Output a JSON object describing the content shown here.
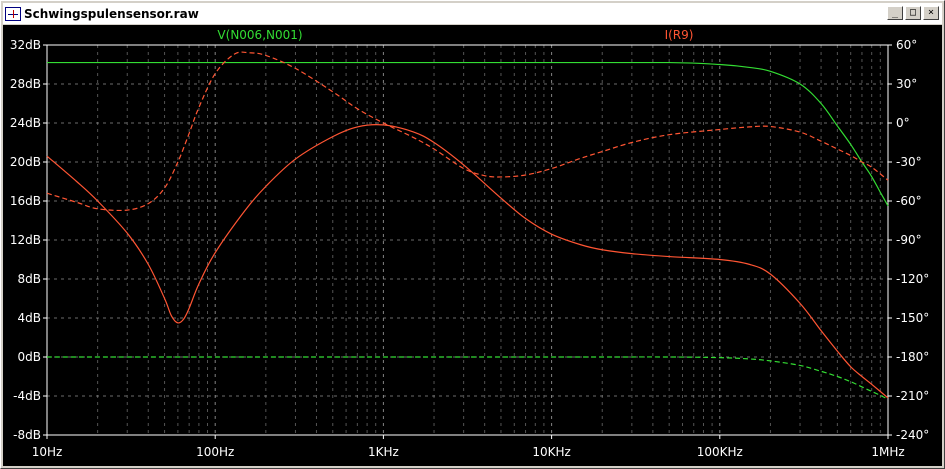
{
  "window": {
    "title": "Schwingspulensensor.raw",
    "min_label": "_",
    "max_label": "□",
    "close_label": "×"
  },
  "colors": {
    "background": "#000000",
    "grid": "#9a9a9a",
    "tick_text": "#ffffff",
    "series_green": "#33dd33",
    "series_red": "#ff5533"
  },
  "chart_data": {
    "type": "line",
    "x_scale": "log",
    "x_range": [
      10,
      1000000
    ],
    "x_ticks": [
      {
        "value": 10,
        "label": "10Hz"
      },
      {
        "value": 100,
        "label": "100Hz"
      },
      {
        "value": 1000,
        "label": "1KHz"
      },
      {
        "value": 10000,
        "label": "10KHz"
      },
      {
        "value": 100000,
        "label": "100KHz"
      },
      {
        "value": 1000000,
        "label": "1MHz"
      }
    ],
    "y_left_range": [
      -8,
      32
    ],
    "y_left_ticks": [
      {
        "value": 32,
        "label": "32dB"
      },
      {
        "value": 28,
        "label": "28dB"
      },
      {
        "value": 24,
        "label": "24dB"
      },
      {
        "value": 20,
        "label": "20dB"
      },
      {
        "value": 16,
        "label": "16dB"
      },
      {
        "value": 12,
        "label": "12dB"
      },
      {
        "value": 8,
        "label": "8dB"
      },
      {
        "value": 4,
        "label": "4dB"
      },
      {
        "value": 0,
        "label": "0dB"
      },
      {
        "value": -4,
        "label": "-4dB"
      },
      {
        "value": -8,
        "label": "-8dB"
      }
    ],
    "y_right_range": [
      -240,
      60
    ],
    "y_right_ticks": [
      {
        "value": 60,
        "label": "60°"
      },
      {
        "value": 30,
        "label": "30°"
      },
      {
        "value": 0,
        "label": "0°"
      },
      {
        "value": -30,
        "label": "-30°"
      },
      {
        "value": -60,
        "label": "-60°"
      },
      {
        "value": -90,
        "label": "-90°"
      },
      {
        "value": -120,
        "label": "-120°"
      },
      {
        "value": -150,
        "label": "-150°"
      },
      {
        "value": -180,
        "label": "-180°"
      },
      {
        "value": -210,
        "label": "-210°"
      },
      {
        "value": -240,
        "label": "-240°"
      }
    ],
    "grid": true,
    "series": [
      {
        "name": "V(N006,N001)",
        "color": "#33dd33",
        "magnitude_db": [
          [
            10,
            30.2
          ],
          [
            1000,
            30.2
          ],
          [
            10000,
            30.2
          ],
          [
            50000,
            30.2
          ],
          [
            100000,
            30.0
          ],
          [
            150000,
            29.7
          ],
          [
            200000,
            29.3
          ],
          [
            300000,
            28.0
          ],
          [
            400000,
            26.0
          ],
          [
            500000,
            23.7
          ],
          [
            600000,
            21.8
          ],
          [
            700000,
            20.0
          ],
          [
            800000,
            18.5
          ],
          [
            900000,
            16.9
          ],
          [
            1000000,
            15.5
          ]
        ],
        "phase_deg": [
          [
            10,
            -180
          ],
          [
            10000,
            -180
          ],
          [
            50000,
            -180
          ],
          [
            100000,
            -180.5
          ],
          [
            150000,
            -181.5
          ],
          [
            200000,
            -183
          ],
          [
            300000,
            -186.5
          ],
          [
            400000,
            -191
          ],
          [
            500000,
            -195
          ],
          [
            600000,
            -199
          ],
          [
            700000,
            -203
          ],
          [
            800000,
            -206.5
          ],
          [
            900000,
            -209.5
          ],
          [
            1000000,
            -212.5
          ]
        ]
      },
      {
        "name": "I(R9)",
        "color": "#ff5533",
        "magnitude_db": [
          [
            10,
            20.6
          ],
          [
            15,
            18.0
          ],
          [
            20,
            16.0
          ],
          [
            30,
            12.7
          ],
          [
            40,
            9.5
          ],
          [
            50,
            6.0
          ],
          [
            55,
            4.2
          ],
          [
            60,
            3.5
          ],
          [
            65,
            3.9
          ],
          [
            70,
            5.0
          ],
          [
            80,
            7.5
          ],
          [
            100,
            10.7
          ],
          [
            150,
            15.0
          ],
          [
            200,
            17.5
          ],
          [
            300,
            20.3
          ],
          [
            500,
            22.6
          ],
          [
            700,
            23.6
          ],
          [
            1000,
            23.8
          ],
          [
            1500,
            23.1
          ],
          [
            2000,
            22.0
          ],
          [
            3000,
            19.7
          ],
          [
            5000,
            16.3
          ],
          [
            7000,
            14.2
          ],
          [
            10000,
            12.6
          ],
          [
            15000,
            11.5
          ],
          [
            20000,
            11.0
          ],
          [
            30000,
            10.6
          ],
          [
            50000,
            10.3
          ],
          [
            100000,
            10.0
          ],
          [
            150000,
            9.5
          ],
          [
            200000,
            8.5
          ],
          [
            300000,
            5.5
          ],
          [
            400000,
            2.7
          ],
          [
            500000,
            0.6
          ],
          [
            600000,
            -1.0
          ],
          [
            700000,
            -2.0
          ],
          [
            800000,
            -2.8
          ],
          [
            1000000,
            -4.2
          ]
        ],
        "phase_deg": [
          [
            10,
            -54
          ],
          [
            15,
            -61
          ],
          [
            20,
            -66
          ],
          [
            30,
            -67
          ],
          [
            40,
            -62
          ],
          [
            50,
            -50
          ],
          [
            60,
            -30
          ],
          [
            70,
            -8
          ],
          [
            80,
            12
          ],
          [
            100,
            38
          ],
          [
            130,
            53
          ],
          [
            160,
            54
          ],
          [
            200,
            52
          ],
          [
            300,
            42
          ],
          [
            500,
            24
          ],
          [
            700,
            11
          ],
          [
            1000,
            0
          ],
          [
            1500,
            -11
          ],
          [
            2000,
            -20
          ],
          [
            3000,
            -35
          ],
          [
            4000,
            -40.5
          ],
          [
            5000,
            -41.5
          ],
          [
            7000,
            -40
          ],
          [
            10000,
            -35
          ],
          [
            15000,
            -27
          ],
          [
            20000,
            -22
          ],
          [
            30000,
            -15
          ],
          [
            50000,
            -9
          ],
          [
            100000,
            -5
          ],
          [
            150000,
            -3
          ],
          [
            200000,
            -2.7
          ],
          [
            300000,
            -7
          ],
          [
            400000,
            -14
          ],
          [
            500000,
            -20
          ],
          [
            600000,
            -25
          ],
          [
            700000,
            -30
          ],
          [
            800000,
            -34
          ],
          [
            1000000,
            -44
          ]
        ]
      }
    ]
  }
}
